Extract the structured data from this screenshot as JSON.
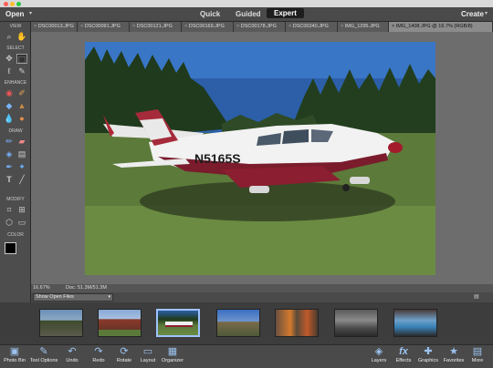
{
  "window": {
    "traffic_lights": [
      "#ff5f57",
      "#ffbd2e",
      "#28c940"
    ]
  },
  "topbar": {
    "open_label": "Open",
    "modes": [
      "Quick",
      "Guided",
      "Expert"
    ],
    "active_mode": "Expert",
    "create_label": "Create"
  },
  "tabs": [
    "DSC00013.JPG",
    "DSC00091.JPG",
    "DSC00121.JPG",
    "DSC00169.JPG",
    "DSC00178.JPG",
    "DSC00240.JPG",
    "IMG_1295.JPG",
    "IMG_1408.JPG @ 16.7% (RGB/8)"
  ],
  "toolbox": {
    "sections": [
      "VIEW",
      "SELECT",
      "ENHANCE",
      "DRAW",
      "MODIFY",
      "COLOR"
    ]
  },
  "status": {
    "zoom": "16.67%",
    "doc": "Doc: 51.3M/51.3M"
  },
  "photobin": {
    "filter_value": "Show Open Files"
  },
  "photo": {
    "tail_number": "N5165S"
  },
  "bottombar": {
    "items": [
      "Photo Bin",
      "Tool Options",
      "Undo",
      "Redo",
      "Rotate",
      "Layout",
      "Organizer",
      "Layers",
      "Effects",
      "Graphics",
      "Favorites",
      "More"
    ]
  }
}
